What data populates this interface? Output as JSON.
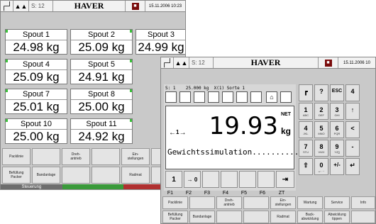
{
  "back_panel": {
    "topbar": {
      "level_icon": "graph-icon",
      "scale_icon": "scale-icon",
      "s_label": "S: 12",
      "brand": "HAVER",
      "alarm_icon": "alarm-icon",
      "datetime": "15.11.2006 10:23"
    },
    "spouts": [
      {
        "name": "Spout 1",
        "value": "24.98 kg"
      },
      {
        "name": "Spout 2",
        "value": "25.09 kg"
      },
      {
        "name": "Spout 3",
        "value": "24.99 kg"
      },
      {
        "name": "Spout 4",
        "value": "25.09 kg"
      },
      {
        "name": "Spout 5",
        "value": "24.91 kg"
      },
      {
        "name": "Spout 7",
        "value": "25.01 kg"
      },
      {
        "name": "Spout 8",
        "value": "25.00 kg"
      },
      {
        "name": "Spout 10",
        "value": "25.00 kg"
      },
      {
        "name": "Spout 11",
        "value": "24.92 kg"
      }
    ],
    "buttons_row1": [
      "Packlinie",
      "",
      "Dreh-\nantrieb",
      "",
      "Ein-\nstellungen",
      "W"
    ],
    "buttons_row2": [
      "Befüllung\nPacker",
      "Bandanlage",
      "",
      "",
      "Radmat",
      "ab"
    ],
    "status": [
      "Steuerung",
      "",
      ""
    ],
    "status_colors": [
      "#6d6d6d",
      "#3a9a3a",
      "#b03030"
    ]
  },
  "front_panel": {
    "topbar": {
      "level_icon": "graph-icon",
      "scale_icon": "scale-icon",
      "s_label": "S: 12",
      "brand": "HAVER",
      "alarm_icon": "alarm-icon",
      "datetime": "15.11.2006 10"
    },
    "lcd": {
      "line1": "S: 1    25.000 kg  X(1) Sorte 1",
      "weight": "19.93",
      "net": "NET",
      "unit": "kg",
      "mode_text": "Gewichtssimulation..........",
      "arrow_label": "1"
    },
    "fkeys": [
      {
        "symbol": "1",
        "label": "F1"
      },
      {
        "symbol": "→ 0 ←",
        "label": "F2"
      },
      {
        "symbol": "",
        "label": "F3"
      },
      {
        "symbol": "",
        "label": "F4"
      },
      {
        "symbol": "",
        "label": "F5"
      },
      {
        "symbol": "",
        "label": "F6"
      },
      {
        "symbol": "⇥",
        "label": "ZT"
      }
    ],
    "keypad": [
      {
        "main": "┏",
        "sub": ""
      },
      {
        "main": "?",
        "sub": ""
      },
      {
        "main": "ESC",
        "sub": ""
      },
      {
        "main": "4",
        "sub": ""
      },
      {
        "main": "1",
        "sub": "ABC"
      },
      {
        "main": "2",
        "sub": "DEF"
      },
      {
        "main": "3",
        "sub": "GHI"
      },
      {
        "main": "↑",
        "sub": ""
      },
      {
        "main": "4",
        "sub": "JKL"
      },
      {
        "main": "5",
        "sub": "MNO"
      },
      {
        "main": "6",
        "sub": "PQR"
      },
      {
        "main": "<",
        "sub": ""
      },
      {
        "main": "7",
        "sub": "STU"
      },
      {
        "main": "8",
        "sub": "VWX"
      },
      {
        "main": "9",
        "sub": "YZ[]"
      },
      {
        "main": "-",
        "sub": ""
      },
      {
        "main": "⇧",
        "sub": ""
      },
      {
        "main": "0",
        "sub": "␣.,→"
      },
      {
        "main": "+/-",
        "sub": ""
      },
      {
        "main": "↵",
        "sub": ""
      }
    ],
    "buttons_row1": [
      "Packlinie",
      "",
      "Dreh-\nantrieb",
      "",
      "Ein-\nstellungen",
      "Wartung",
      "Service",
      "Info"
    ],
    "buttons_row2": [
      "Befüllung\nPacker",
      "Bandanlage",
      "",
      "",
      "Radmat",
      "Back-\nabwicklung",
      "Abwicklung\ntippen",
      ""
    ]
  }
}
